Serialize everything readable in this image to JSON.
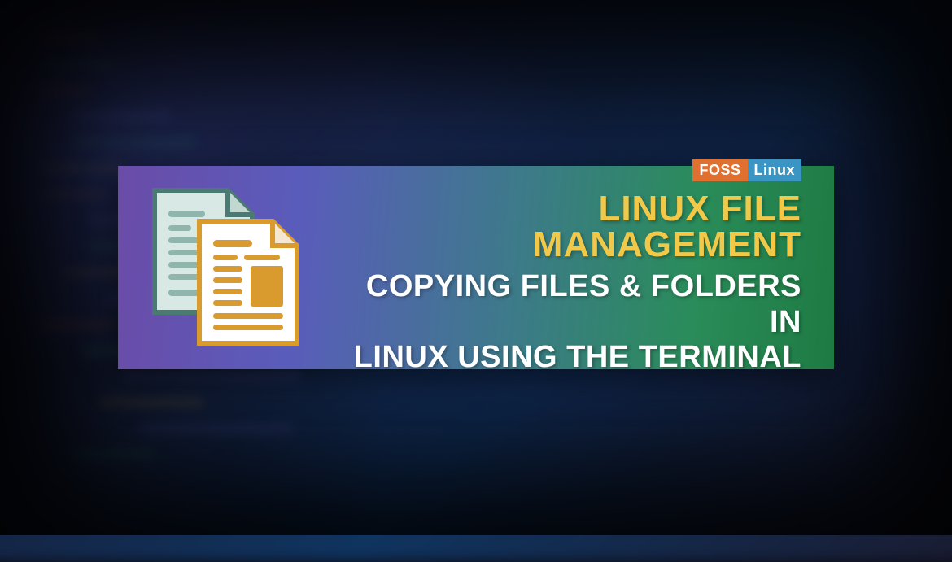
{
  "logo": {
    "part1": "FOSS",
    "part2": "Linux"
  },
  "banner": {
    "title": "LINUX FILE MANAGEMENT",
    "subtitle_line1": "COPYING FILES & FOLDERS IN",
    "subtitle_line2": "LINUX USING THE TERMINAL"
  },
  "colors": {
    "title_color": "#f2c849",
    "subtitle_color": "#ffffff",
    "gradient_start": "#6b4ba8",
    "gradient_end": "#1e7a42",
    "logo_foss_bg": "#e07030",
    "logo_linux_bg": "#3a95c4"
  }
}
